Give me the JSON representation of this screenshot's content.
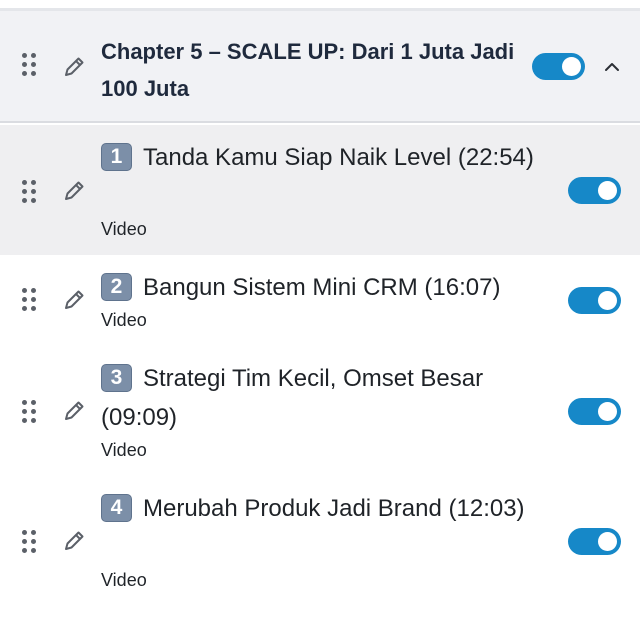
{
  "chapter": {
    "title": "Chapter 5 – SCALE UP: Dari 1 Juta Jadi 100 Juta",
    "enabled": true
  },
  "lessons": [
    {
      "number": "1",
      "title": "Tanda Kamu Siap Naik Level (22:54)",
      "type": "Video",
      "enabled": true
    },
    {
      "number": "2",
      "title": "Bangun Sistem Mini CRM (16:07)",
      "type": "Video",
      "enabled": true
    },
    {
      "number": "3",
      "title": "Strategi Tim Kecil, Omset Besar (09:09)",
      "type": "Video",
      "enabled": true
    },
    {
      "number": "4",
      "title": "Merubah Produk Jadi Brand (12:03)",
      "type": "Video",
      "enabled": true
    }
  ],
  "icons": {
    "drag": "drag-handle-icon",
    "edit": "pencil-icon",
    "collapse": "chevron-up-icon"
  },
  "colors": {
    "toggle_on": "#1688c8",
    "chapter_bg": "#f1f2f5",
    "active_row_bg": "#efeff1",
    "badge": "#7c8fa8"
  }
}
